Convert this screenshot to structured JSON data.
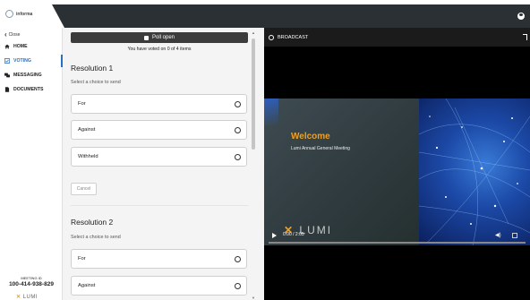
{
  "app": {
    "logo_text": "informa"
  },
  "sidebar": {
    "close_label": "Close",
    "items": [
      {
        "label": "HOME",
        "icon": "home-icon",
        "active": false
      },
      {
        "label": "VOTING",
        "icon": "voting-icon",
        "active": true
      },
      {
        "label": "MESSAGING",
        "icon": "messaging-icon",
        "active": false
      },
      {
        "label": "DOCUMENTS",
        "icon": "documents-icon",
        "active": false
      }
    ],
    "meeting_id_label": "MEETING ID",
    "meeting_id": "100-414-938-829",
    "brand": "LUMI"
  },
  "voting": {
    "poll_status": "Poll open",
    "voted_text": "You have voted on 0 of 4 items",
    "resolutions": [
      {
        "title": "Resolution 1",
        "subtitle": "Select a choice to send",
        "choices": [
          "For",
          "Against",
          "Withheld"
        ],
        "cancel_label": "Cancel"
      },
      {
        "title": "Resolution 2",
        "subtitle": "Select a choice to send",
        "choices": [
          "For",
          "Against"
        ]
      }
    ]
  },
  "broadcast": {
    "header_label": "BROADCAST",
    "slide_title": "Welcome",
    "slide_subtitle": "Lumi Annual General Meeting",
    "slide_brand": "LUMI",
    "time_display": "0:00 / 2:05",
    "progress_fraction": 0.0
  },
  "colors": {
    "accent": "#2c6fbf",
    "topbar_dark": "#2b3035",
    "welcome": "#f0a020"
  }
}
